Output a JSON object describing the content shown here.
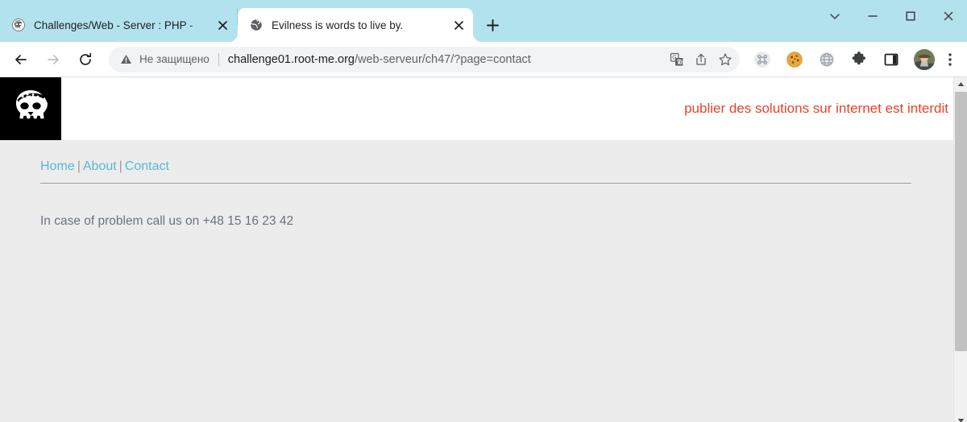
{
  "browser": {
    "tabs": [
      {
        "title": "Challenges/Web - Server : PHP - ",
        "favicon_name": "rootme-skull-favicon",
        "active": false,
        "close_label": "×"
      },
      {
        "title": "Evilness is words to live by.",
        "favicon_name": "globe-favicon",
        "active": true,
        "close_label": "×"
      }
    ],
    "new_tab_label": "+",
    "window_controls": {
      "tab_search_label": "⌄",
      "minimize_label": "—",
      "maximize_label": "□",
      "close_label": "×"
    },
    "toolbar": {
      "back_label": "←",
      "forward_label": "→",
      "reload_label": "↻",
      "security_text": "Не защищено",
      "url_host": "challenge01.root-me.org",
      "url_path": "/web-serveur/ch47/?page=contact",
      "url_full": "challenge01.root-me.org/web-serveur/ch47/?page=contact",
      "omnibox_actions": [
        "translate-icon",
        "share-icon",
        "bookmark-star-icon"
      ],
      "extensions": [
        "command-extension-icon",
        "cookie-extension-icon",
        "globe-extension-icon",
        "puzzle-extensions-icon",
        "side-panel-icon"
      ],
      "profile_name": "profile-avatar",
      "menu_label": "⋮"
    },
    "colors": {
      "tabstrip_bg": "#b3e2ef",
      "toolbar_bg": "#ffffff",
      "omnibox_bg": "#f1f3f4"
    }
  },
  "page": {
    "logo_name": "rootme-skull-logo",
    "banner_text": "publier des solutions sur internet est interdit",
    "banner_color": "#e8432a",
    "nav": {
      "items": [
        {
          "label": "Home"
        },
        {
          "label": "About"
        },
        {
          "label": "Contact"
        }
      ],
      "separator": "|",
      "link_color": "#5bb8d4"
    },
    "body_text": "In case of problem call us on +48 15 16 23 42",
    "background_color": "#ececec"
  },
  "scrollbar": {
    "up_arrow": "▲",
    "down_arrow": "▼"
  }
}
